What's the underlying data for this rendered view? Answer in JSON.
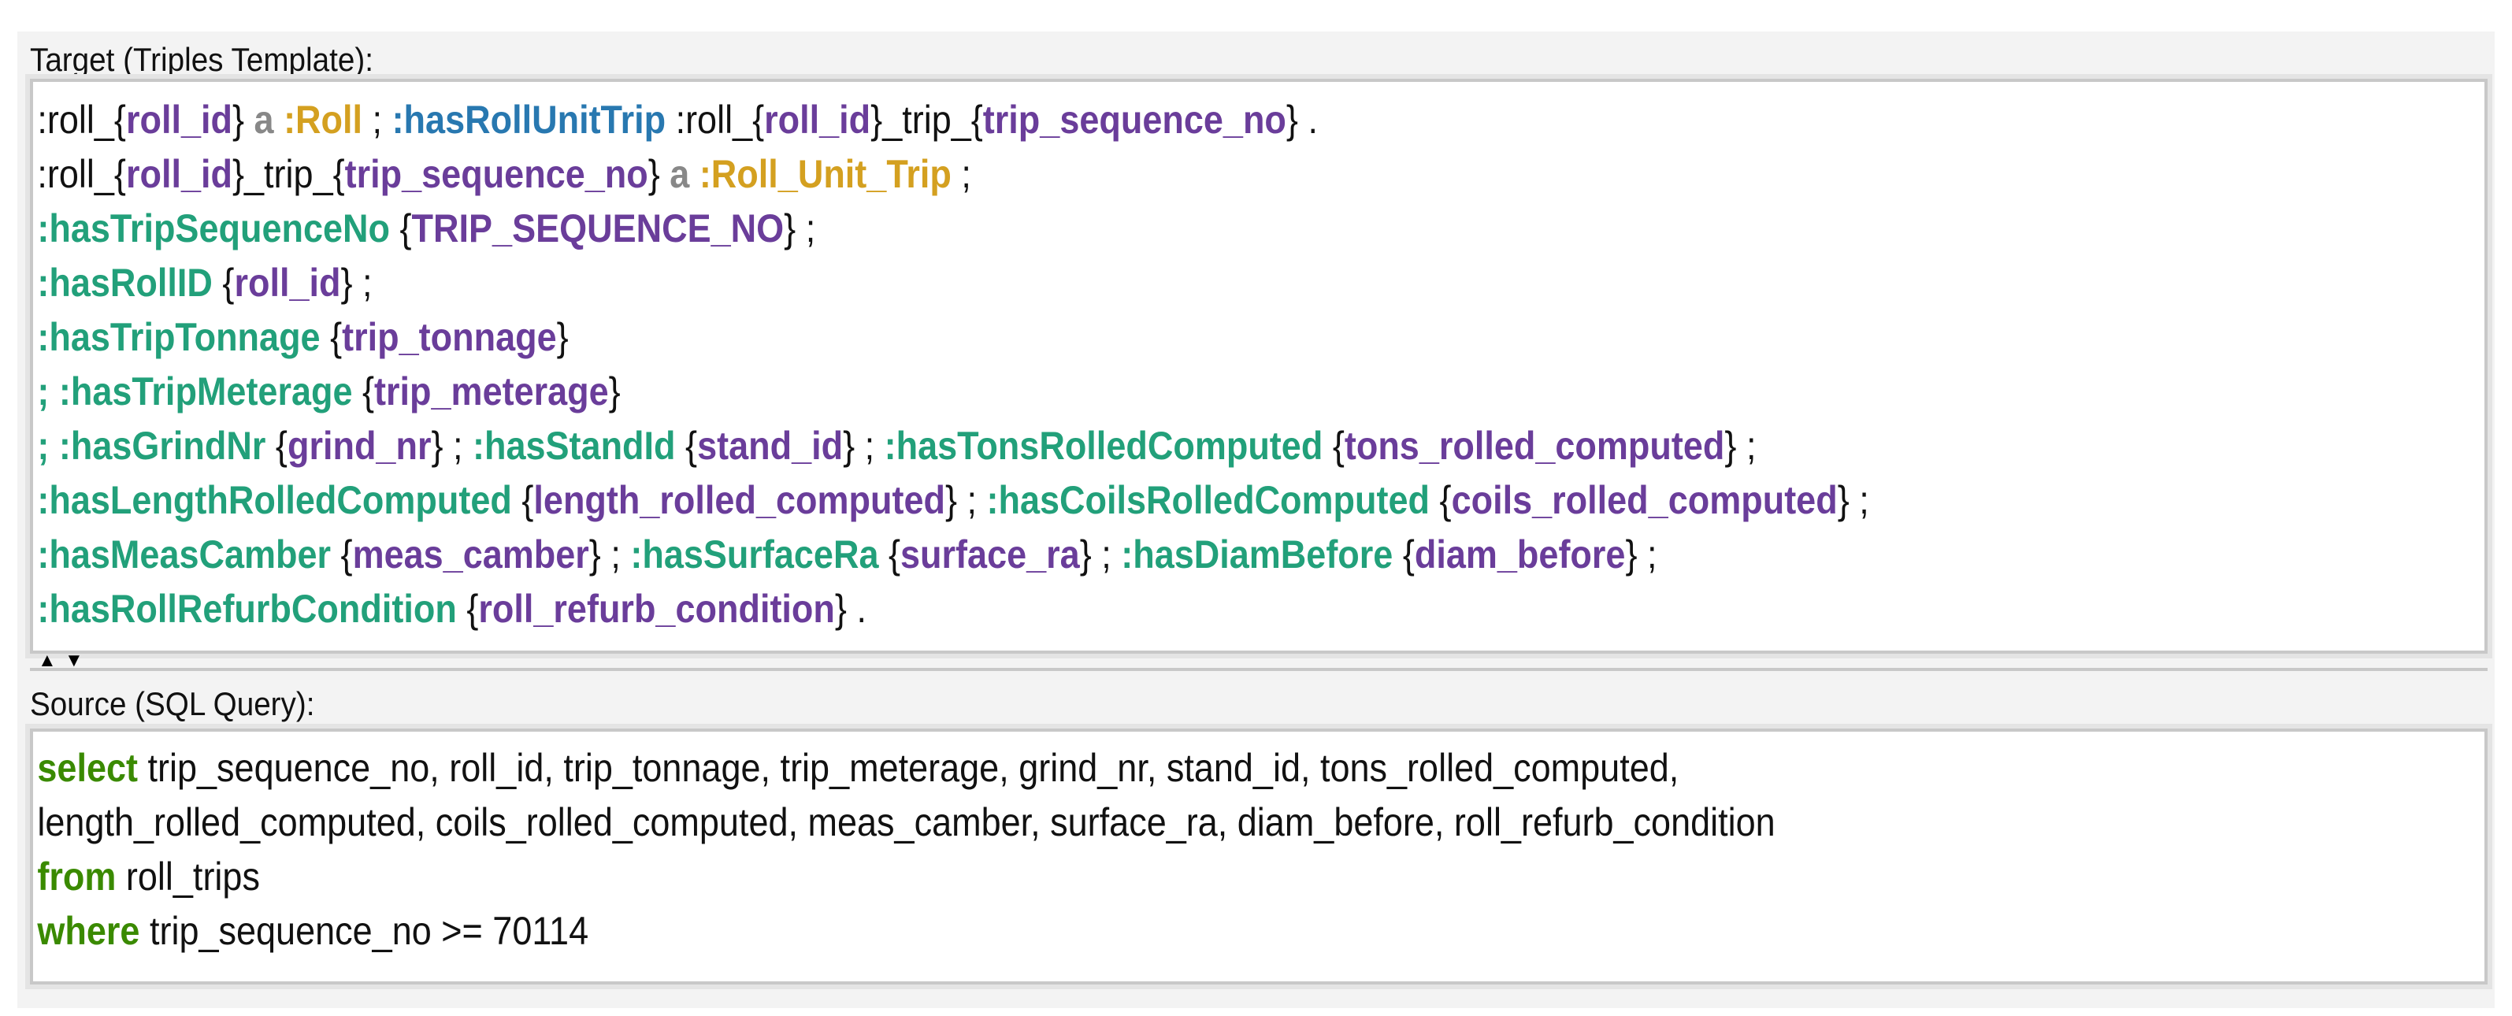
{
  "target": {
    "label": "Target (Triples Template):",
    "lines": [
      [
        {
          "t": ":roll_{",
          "c": "plain"
        },
        {
          "t": "roll_id",
          "c": "var"
        },
        {
          "t": "} ",
          "c": "plain"
        },
        {
          "t": "a ",
          "c": "a"
        },
        {
          "t": ":Roll",
          "c": "class"
        },
        {
          "t": " ; ",
          "c": "plain"
        },
        {
          "t": ":hasRollUnitTrip",
          "c": "link"
        },
        {
          "t": " :roll_{",
          "c": "plain"
        },
        {
          "t": "roll_id",
          "c": "var"
        },
        {
          "t": "}_trip_{",
          "c": "plain"
        },
        {
          "t": "trip_sequence_no",
          "c": "var"
        },
        {
          "t": "} .",
          "c": "plain"
        }
      ],
      [
        {
          "t": ":roll_{",
          "c": "plain"
        },
        {
          "t": "roll_id",
          "c": "var"
        },
        {
          "t": "}_trip_{",
          "c": "plain"
        },
        {
          "t": "trip_sequence_no",
          "c": "var"
        },
        {
          "t": "} ",
          "c": "plain"
        },
        {
          "t": "a ",
          "c": "a"
        },
        {
          "t": ":Roll_Unit_Trip",
          "c": "class"
        },
        {
          "t": " ;",
          "c": "plain"
        }
      ],
      [
        {
          "t": ":hasTripSequenceNo",
          "c": "pred"
        },
        {
          "t": " {",
          "c": "plain"
        },
        {
          "t": "TRIP_SEQUENCE_NO",
          "c": "var"
        },
        {
          "t": "} ;",
          "c": "plain"
        }
      ],
      [
        {
          "t": ":hasRollID",
          "c": "pred"
        },
        {
          "t": " {",
          "c": "plain"
        },
        {
          "t": "roll_id",
          "c": "var"
        },
        {
          "t": "} ;",
          "c": "plain"
        }
      ],
      [
        {
          "t": ":hasTripTonnage",
          "c": "pred"
        },
        {
          "t": " {",
          "c": "plain"
        },
        {
          "t": "trip_tonnage",
          "c": "var"
        },
        {
          "t": "}",
          "c": "plain"
        }
      ],
      [
        {
          "t": "; ",
          "c": "pred"
        },
        {
          "t": ":hasTripMeterage",
          "c": "pred"
        },
        {
          "t": " {",
          "c": "plain"
        },
        {
          "t": "trip_meterage",
          "c": "var"
        },
        {
          "t": "}",
          "c": "plain"
        }
      ],
      [
        {
          "t": "; ",
          "c": "pred"
        },
        {
          "t": ":hasGrindNr",
          "c": "pred"
        },
        {
          "t": " {",
          "c": "plain"
        },
        {
          "t": "grind_nr",
          "c": "var"
        },
        {
          "t": "} ; ",
          "c": "plain"
        },
        {
          "t": ":hasStandId",
          "c": "pred"
        },
        {
          "t": " {",
          "c": "plain"
        },
        {
          "t": "stand_id",
          "c": "var"
        },
        {
          "t": "} ; ",
          "c": "plain"
        },
        {
          "t": ":hasTonsRolledComputed",
          "c": "pred"
        },
        {
          "t": " {",
          "c": "plain"
        },
        {
          "t": "tons_rolled_computed",
          "c": "var"
        },
        {
          "t": "} ;",
          "c": "plain"
        }
      ],
      [
        {
          "t": ":hasLengthRolledComputed",
          "c": "pred"
        },
        {
          "t": " {",
          "c": "plain"
        },
        {
          "t": "length_rolled_computed",
          "c": "var"
        },
        {
          "t": "} ; ",
          "c": "plain"
        },
        {
          "t": ":hasCoilsRolledComputed",
          "c": "pred"
        },
        {
          "t": " {",
          "c": "plain"
        },
        {
          "t": "coils_rolled_computed",
          "c": "var"
        },
        {
          "t": "} ;",
          "c": "plain"
        }
      ],
      [
        {
          "t": ":hasMeasCamber",
          "c": "pred"
        },
        {
          "t": " {",
          "c": "plain"
        },
        {
          "t": "meas_camber",
          "c": "var"
        },
        {
          "t": "} ; ",
          "c": "plain"
        },
        {
          "t": ":hasSurfaceRa",
          "c": "pred"
        },
        {
          "t": " {",
          "c": "plain"
        },
        {
          "t": "surface_ra",
          "c": "var"
        },
        {
          "t": "} ; ",
          "c": "plain"
        },
        {
          "t": ":hasDiamBefore",
          "c": "pred"
        },
        {
          "t": " {",
          "c": "plain"
        },
        {
          "t": "diam_before",
          "c": "var"
        },
        {
          "t": "} ;",
          "c": "plain"
        }
      ],
      [
        {
          "t": ":hasRollRefurbCondition",
          "c": "pred"
        },
        {
          "t": " {",
          "c": "plain"
        },
        {
          "t": "roll_refurb_condition",
          "c": "var"
        },
        {
          "t": "} .",
          "c": "plain"
        }
      ]
    ]
  },
  "splitter": {
    "up_icon": "▲",
    "down_icon": "▼"
  },
  "source": {
    "label": "Source (SQL Query):",
    "lines": [
      [
        {
          "t": "select",
          "c": "kw"
        },
        {
          "t": " trip_sequence_no, roll_id, trip_tonnage, trip_meterage, grind_nr, stand_id, tons_rolled_computed,",
          "c": "sql"
        }
      ],
      [
        {
          "t": "length_rolled_computed, coils_rolled_computed, meas_camber, surface_ra, diam_before, roll_refurb_condition",
          "c": "sql"
        }
      ],
      [
        {
          "t": "from",
          "c": "kw"
        },
        {
          "t": " roll_trips",
          "c": "sql"
        }
      ],
      [
        {
          "t": "where",
          "c": "kw"
        },
        {
          "t": " trip_sequence_no >= 70114",
          "c": "sql"
        }
      ]
    ]
  }
}
